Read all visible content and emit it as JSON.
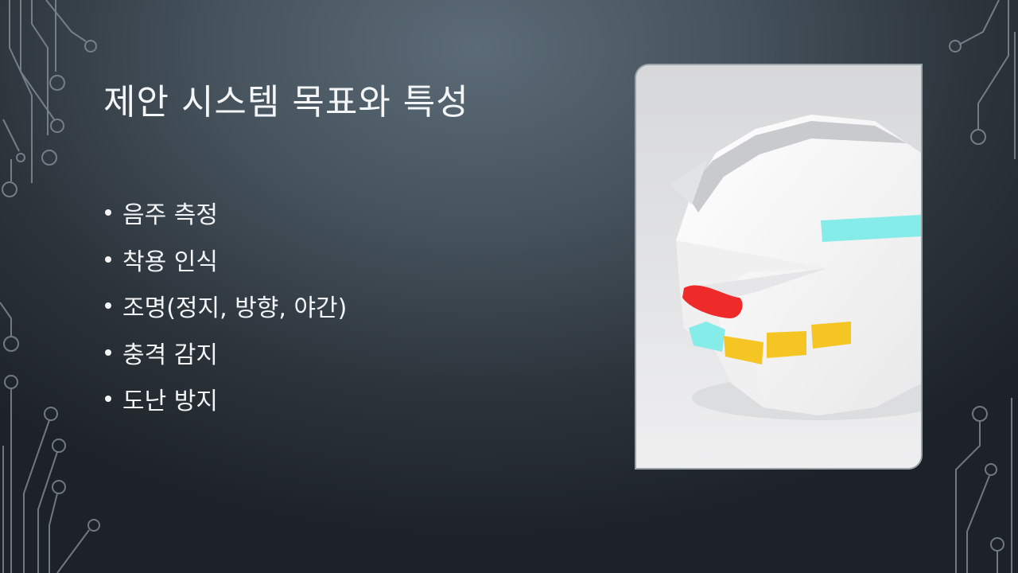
{
  "slide": {
    "title": "제안 시스템 목표와 특성",
    "bullets": [
      "음주 측정",
      "착용 인식",
      "조명(정지, 방향, 야간)",
      "충격 감지",
      "도난 방지"
    ]
  },
  "colors": {
    "background_center": "#5b6b77",
    "background_edge": "#1c2227",
    "circuit_lines": "#8a969e",
    "text": "#f2f4f5",
    "helmet_body": "#ffffff",
    "helmet_visor": "#c8cacd",
    "cyan_light": "#86ecea",
    "red_light": "#ee2a2a",
    "yellow_light": "#f5c623"
  }
}
